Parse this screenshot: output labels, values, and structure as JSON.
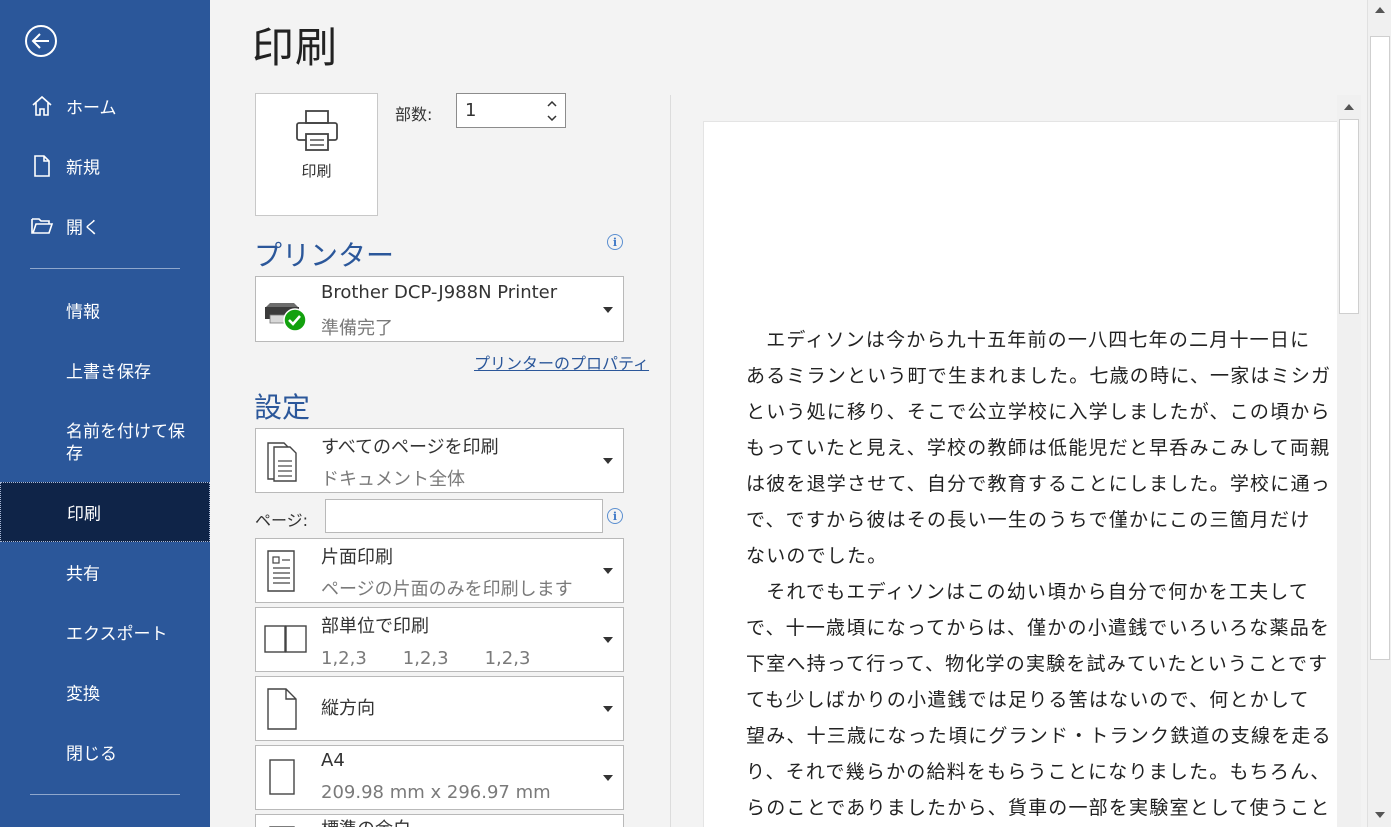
{
  "sidebar": {
    "items": [
      {
        "label": "ホーム"
      },
      {
        "label": "新規"
      },
      {
        "label": "開く"
      },
      {
        "label": "情報"
      },
      {
        "label": "上書き保存"
      },
      {
        "label": "名前を付けて保存"
      },
      {
        "label": "印刷"
      },
      {
        "label": "共有"
      },
      {
        "label": "エクスポート"
      },
      {
        "label": "変換"
      },
      {
        "label": "閉じる"
      }
    ]
  },
  "page_title": "印刷",
  "print_button_label": "印刷",
  "copies": {
    "label": "部数:",
    "value": "1"
  },
  "printer": {
    "section_title": "プリンター",
    "name": "Brother DCP-J988N Printer",
    "status": "準備完了",
    "properties_link": "プリンターのプロパティ"
  },
  "settings": {
    "section_title": "設定",
    "pages_label": "ページ:",
    "options": [
      {
        "main": "すべてのページを印刷",
        "sub": "ドキュメント全体"
      },
      {
        "main": "片面印刷",
        "sub": "ページの片面のみを印刷します"
      },
      {
        "main": "部単位で印刷",
        "sub": "1,2,3　　1,2,3　　1,2,3"
      },
      {
        "main": "縦方向",
        "sub": ""
      },
      {
        "main": "A4",
        "sub": "209.98 mm x 296.97 mm"
      },
      {
        "main": "標準の余白",
        "sub": ""
      }
    ]
  },
  "preview": {
    "lines": [
      "　エディソンは今から九十五年前の一八四七年の二月十一日に",
      "あるミランという町で生まれました。七歳の時に、一家はミシガ",
      "という処に移り、そこで公立学校に入学しましたが、この頃から",
      "もっていたと見え、学校の教師は低能児だと早呑みこみして両親",
      "は彼を退学させて、自分で教育することにしました。学校に通っ",
      "で、ですから彼はその長い一生のうちで僅かにこの三箇月だけ",
      "ないのでした。",
      "　それでもエディソンはこの幼い頃から自分で何かを工夫して",
      "で、十一歳頃になってからは、僅かの小遣銭でいろいろな薬品を",
      "下室へ持って行って、物化学の実験を試みていたということです",
      "ても少しばかりの小遣銭では足りる筈はないので、何とかして",
      "望み、十三歳になった頃にグランド・トランク鉄道の支線を走る",
      "り、それで幾らかの給料をもらうことになりました。もちろん、",
      "らのことでありましたから、貨車の一部を実験室として使うこと"
    ]
  }
}
